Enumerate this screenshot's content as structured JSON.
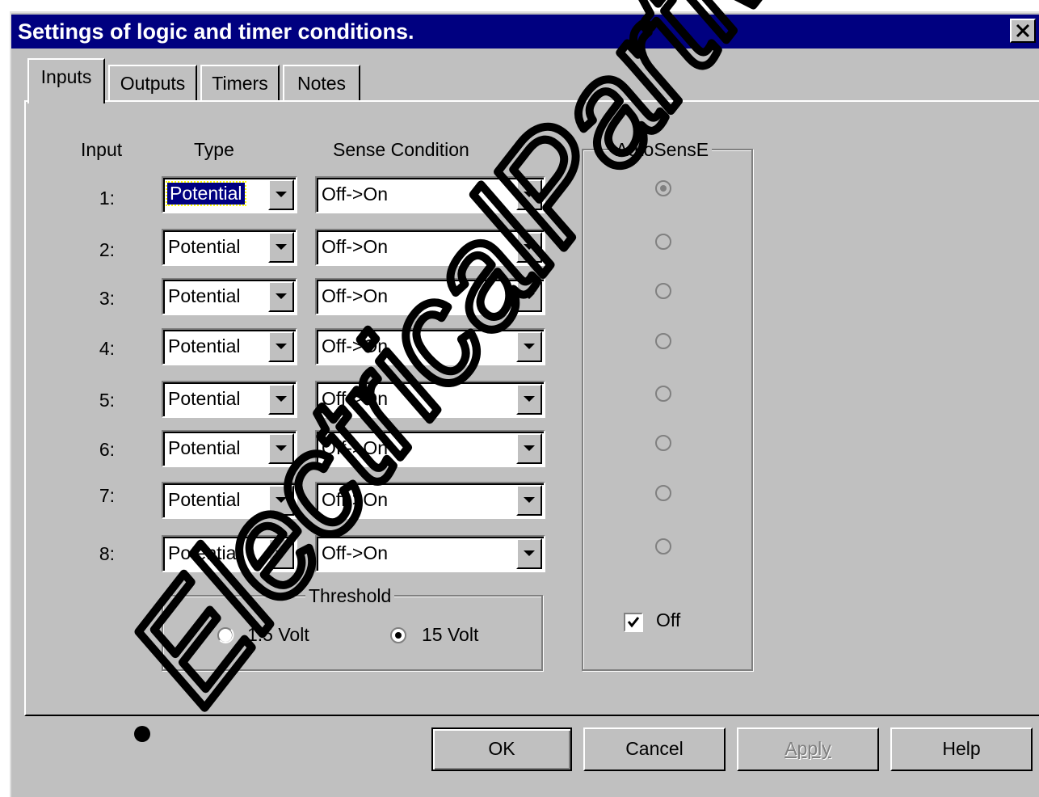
{
  "window": {
    "title": "Settings of logic and timer conditions."
  },
  "tabs": [
    {
      "label": "Inputs",
      "active": true
    },
    {
      "label": "Outputs",
      "active": false
    },
    {
      "label": "Timers",
      "active": false
    },
    {
      "label": "Notes",
      "active": false
    }
  ],
  "headers": {
    "input": "Input",
    "type": "Type",
    "sense": "Sense Condition"
  },
  "rows": [
    {
      "label": "1:",
      "type": "Potential",
      "sense": "Off->On"
    },
    {
      "label": "2:",
      "type": "Potential",
      "sense": "Off->On"
    },
    {
      "label": "3:",
      "type": "Potential",
      "sense": "Off->On"
    },
    {
      "label": "4:",
      "type": "Potential",
      "sense": "Off->On"
    },
    {
      "label": "5:",
      "type": "Potential",
      "sense": "Off->On"
    },
    {
      "label": "6:",
      "type": "Potential",
      "sense": "Off->On"
    },
    {
      "label": "7:",
      "type": "Potential",
      "sense": "Off->On"
    },
    {
      "label": "8:",
      "type": "Potential",
      "sense": "Off->On"
    }
  ],
  "threshold": {
    "title": "Threshold",
    "options": [
      {
        "label": "1.5 Volt",
        "selected": false
      },
      {
        "label": "15 Volt",
        "selected": true
      }
    ]
  },
  "autosense": {
    "title": "AutoSensE",
    "radios": [
      true,
      false,
      false,
      false,
      false,
      false,
      false,
      false
    ],
    "off_label": "Off",
    "off_checked": true
  },
  "buttons": {
    "ok": "OK",
    "cancel": "Cancel",
    "apply": "Apply",
    "help": "Help"
  },
  "watermark": {
    "text": "ElectricalPartM"
  },
  "colors": {
    "titlebar": "#000080",
    "face": "#c0c0c0"
  }
}
